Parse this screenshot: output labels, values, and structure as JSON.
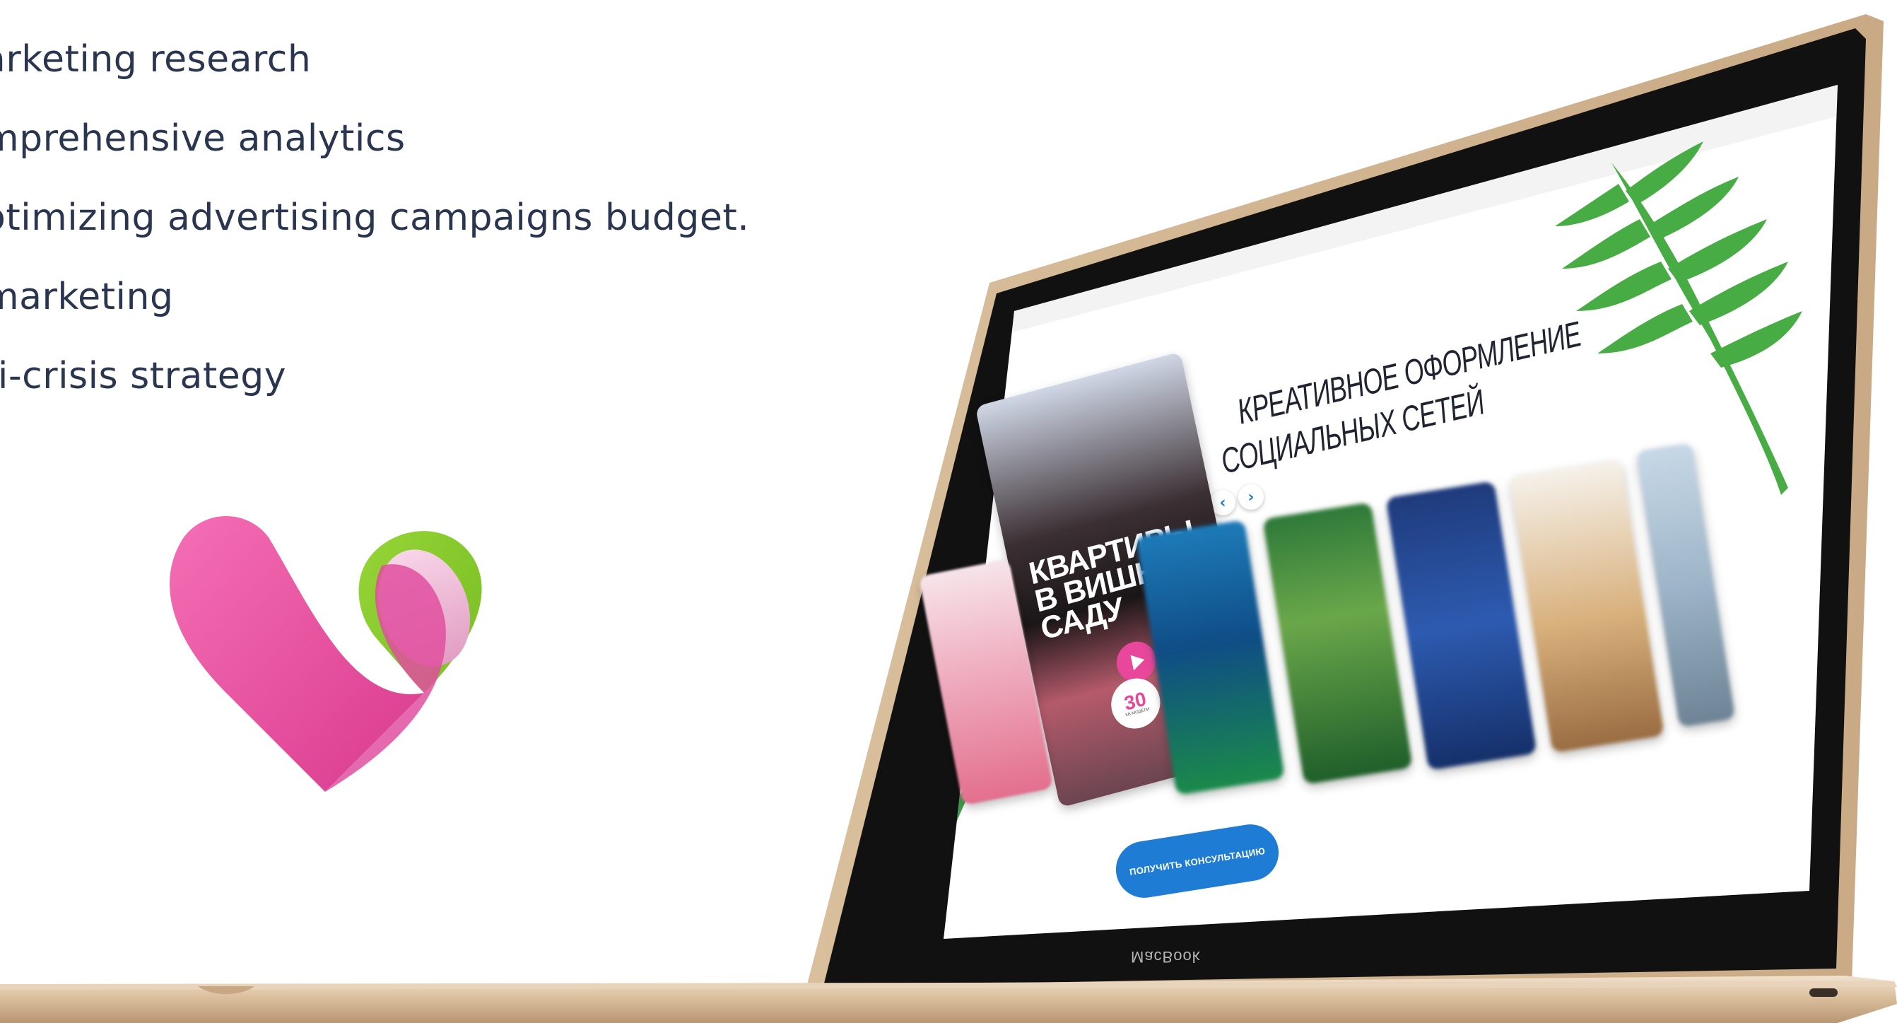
{
  "services": [
    "arketing research",
    "mprehensive analytics",
    "otimizing advertising campaigns budget.",
    "marketing",
    "ti-crisis strategy"
  ],
  "laptop": {
    "brand": "MacBook",
    "website": {
      "headline_line1": "КРЕАТИВНОЕ ОФОРМЛЕНИЕ",
      "headline_line2": "СОЦИАЛЬНЫХ СЕТЕЙ",
      "cta_label": "ПОЛУЧИТЬ КОНСУЛЬТАЦИЮ",
      "prev_arrow": "‹",
      "next_arrow": "›",
      "featured_card": {
        "title_line1": "КВАРТИРЫ",
        "title_line2": "В ВИШНЕВОМ",
        "title_line3": "САДУ",
        "price": "30",
        "price_unit": "КВ.МОДЕЛИ"
      }
    }
  },
  "colors": {
    "text": "#2a3550",
    "accent_blue": "#1f7cd4",
    "heart_pink": "#e8479b",
    "heart_green": "#8ccf2e",
    "laptop_gold": "#d9bf9c"
  }
}
